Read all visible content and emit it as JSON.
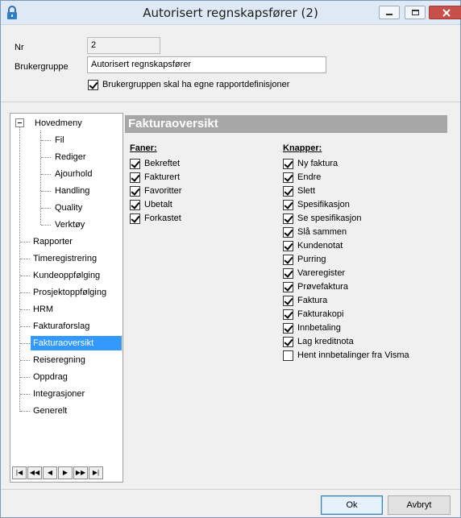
{
  "window": {
    "title": "Autorisert regnskapsfører (2)"
  },
  "form": {
    "nr_label": "Nr",
    "nr_value": "2",
    "group_label": "Brukergruppe",
    "group_value": "Autorisert regnskapsfører",
    "own_reports_label": "Brukergruppen skal ha egne rapportdefinisjoner",
    "own_reports_checked": true
  },
  "tree": {
    "root": "Hovedmeny",
    "children": [
      "Fil",
      "Rediger",
      "Ajourhold",
      "Handling",
      "Quality",
      "Verktøy"
    ],
    "items": [
      "Rapporter",
      "Timeregistrering",
      "Kundeoppfølging",
      "Prosjektoppfølging",
      "HRM",
      "Fakturaforslag",
      "Fakturaoversikt",
      "Reiseregning",
      "Oppdrag",
      "Integrasjoner",
      "Generelt"
    ],
    "selected": "Fakturaoversikt"
  },
  "nav": [
    "|◀",
    "◀◀",
    "◀",
    "▶",
    "▶▶",
    "▶|"
  ],
  "panel": {
    "title": "Fakturaoversikt",
    "tabs_title": "Faner:",
    "tabs": [
      {
        "label": "Bekreftet",
        "checked": true
      },
      {
        "label": "Fakturert",
        "checked": true
      },
      {
        "label": "Favoritter",
        "checked": true
      },
      {
        "label": "Ubetalt",
        "checked": true
      },
      {
        "label": "Forkastet",
        "checked": true
      }
    ],
    "buttons_title": "Knapper:",
    "buttons": [
      {
        "label": "Ny faktura",
        "checked": true
      },
      {
        "label": "Endre",
        "checked": true
      },
      {
        "label": "Slett",
        "checked": true
      },
      {
        "label": "Spesifikasjon",
        "checked": true
      },
      {
        "label": "Se spesifikasjon",
        "checked": true
      },
      {
        "label": "Slå sammen",
        "checked": true
      },
      {
        "label": "Kundenotat",
        "checked": true
      },
      {
        "label": "Purring",
        "checked": true
      },
      {
        "label": "Vareregister",
        "checked": true
      },
      {
        "label": "Prøvefaktura",
        "checked": true
      },
      {
        "label": "Faktura",
        "checked": true
      },
      {
        "label": "Fakturakopi",
        "checked": true
      },
      {
        "label": "Innbetaling",
        "checked": true
      },
      {
        "label": "Lag kreditnota",
        "checked": true
      },
      {
        "label": "Hent innbetalinger fra Visma",
        "checked": false
      }
    ]
  },
  "footer": {
    "ok_label": "Ok",
    "cancel_label": "Avbryt"
  }
}
